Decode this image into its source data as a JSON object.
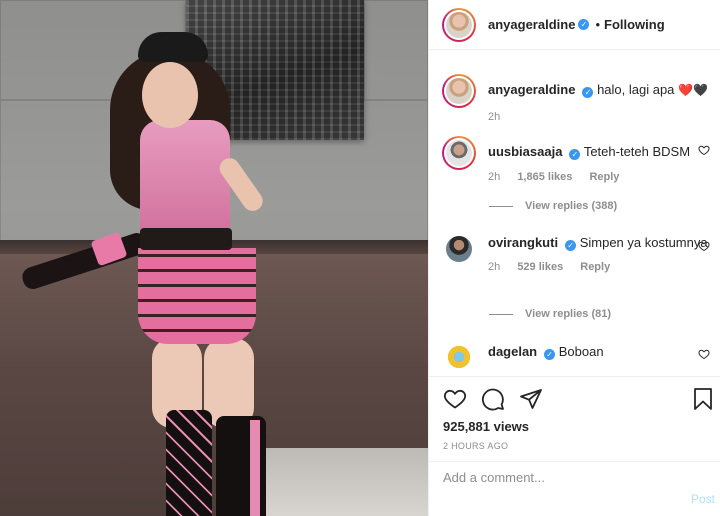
{
  "post": {
    "author": "anyageraldine",
    "follow_status": "Following",
    "separator": "•"
  },
  "caption": {
    "username": "anyageraldine",
    "text": "halo, lagi apa",
    "emojis": "❤️🖤",
    "time": "2h"
  },
  "comments": [
    {
      "username": "uusbiasaaja",
      "text": "Teteh-teteh BDSM",
      "time": "2h",
      "likes": "1,865 likes",
      "reply_label": "Reply",
      "view_replies": "View replies (388)"
    },
    {
      "username": "ovirangkuti",
      "text": "Simpen ya kostumnya",
      "time": "2h",
      "likes": "529 likes",
      "reply_label": "Reply",
      "view_replies": "View replies (81)"
    },
    {
      "username": "dagelan",
      "text": "Boboan"
    }
  ],
  "footer": {
    "views": "925,881 views",
    "timestamp": "2 HOURS AGO",
    "comment_placeholder": "Add a comment...",
    "post_label": "Post"
  },
  "icons": {
    "verified": "verified-badge",
    "like": "heart-icon",
    "comment": "comment-icon",
    "share": "paper-plane-icon",
    "save": "bookmark-icon"
  },
  "colors": {
    "verified_blue": "#3897f0",
    "muted_text": "#8e8e8e",
    "post_button": "#b2dffc"
  }
}
